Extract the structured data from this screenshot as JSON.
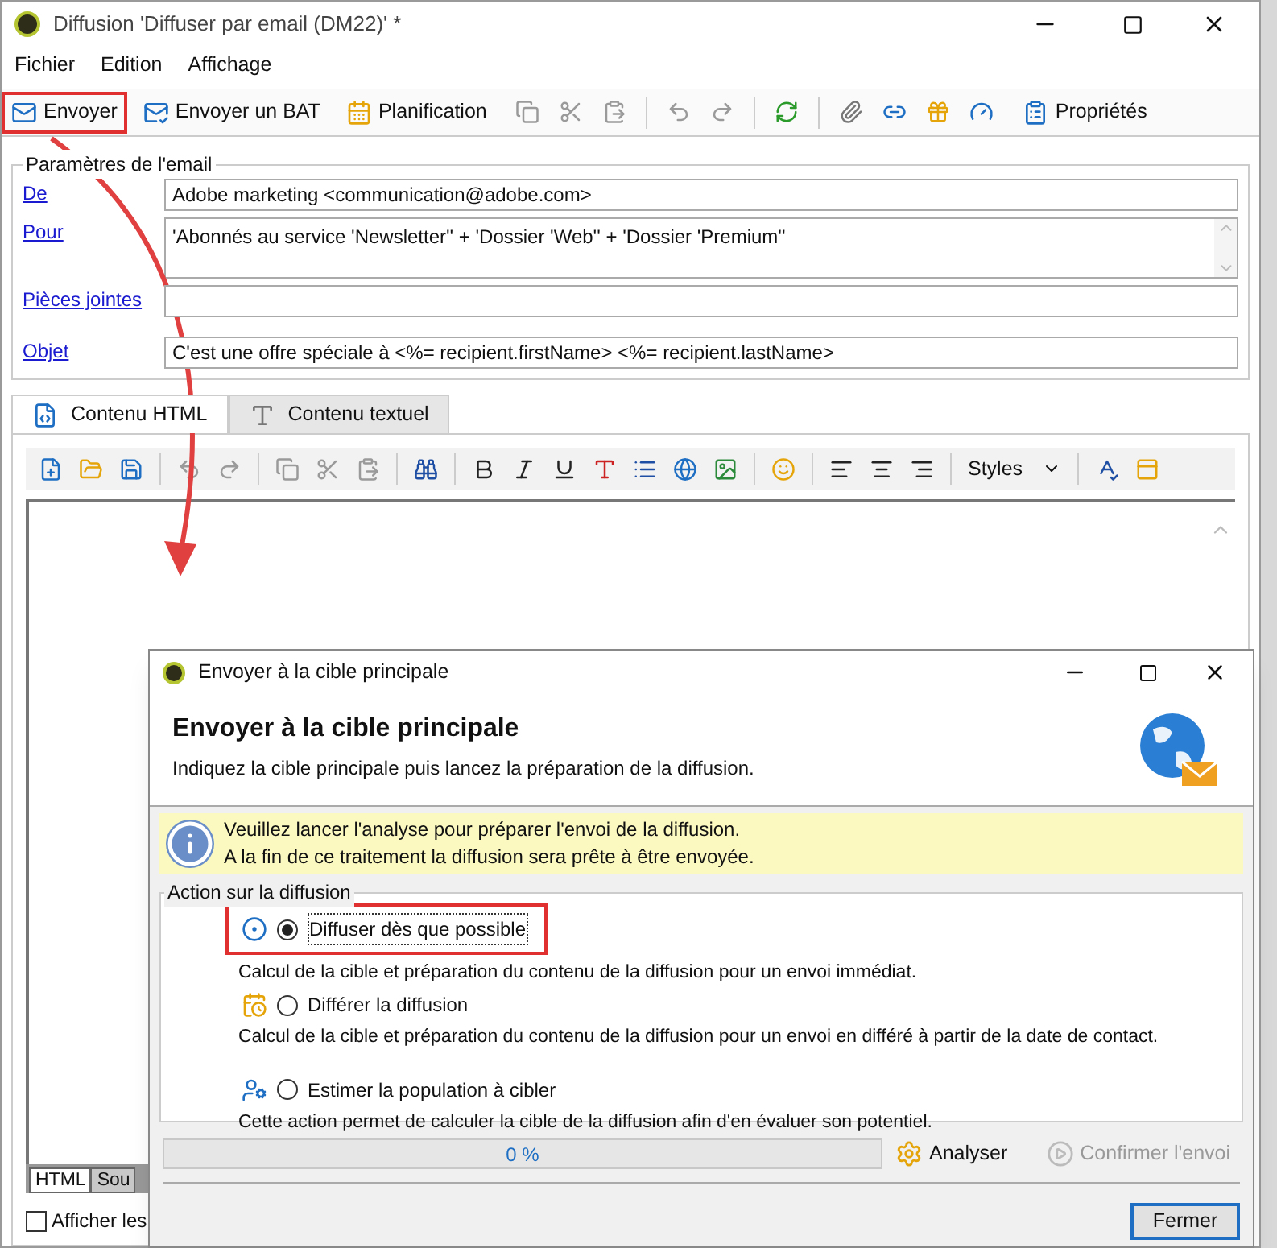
{
  "window": {
    "title": "Diffusion 'Diffuser par email (DM22)' *"
  },
  "menu": [
    "Fichier",
    "Edition",
    "Affichage"
  ],
  "toolbar": [
    {
      "kind": "send",
      "label": "Envoyer",
      "highlighted": true
    },
    {
      "kind": "proof",
      "label": "Envoyer un BAT",
      "highlighted": false
    },
    {
      "kind": "schedule",
      "label": "Planification",
      "highlighted": false
    },
    {
      "kind": "properties",
      "label": "Propriétés",
      "highlighted": false
    }
  ],
  "email_params": {
    "title": "Paramètres de l'email",
    "fields": [
      {
        "kind": "line",
        "label": "De",
        "value": "Adobe marketing <communication@adobe.com>"
      },
      {
        "kind": "area",
        "label": "Pour",
        "value": "'Abonnés au service 'Newsletter'' + 'Dossier 'Web'' + 'Dossier 'Premium''"
      },
      {
        "kind": "line",
        "label": "Pièces jointes"
      },
      {
        "kind": "line",
        "label": "Objet",
        "value": "C'est une offre  spéciale  à  <%= recipient.firstName> <%= recipient.lastName>"
      }
    ]
  },
  "editor": {
    "tabs": [
      {
        "kind": "html",
        "label": "Contenu HTML",
        "selected": true
      },
      {
        "kind": "text",
        "label": "Contenu textuel",
        "selected": false
      }
    ],
    "styles": "Styles",
    "bottom_tabs": [
      {
        "label": "HTML",
        "selected": true
      },
      {
        "label": "Sou",
        "selected": false
      }
    ],
    "checkbox": {
      "label": "Afficher les",
      "checked": false
    }
  },
  "dialog": {
    "title": "Envoyer à la cible principale",
    "heading": "Envoyer à la cible principale",
    "subheading": "Indiquez la cible principale puis lancez la préparation de la diffusion.",
    "info": [
      "Veuillez lancer l'analyse pour préparer l'envoi de la diffusion.",
      "A la fin de ce traitement la diffusion sera prête à être envoyée."
    ],
    "group": "Action sur la diffusion",
    "options": [
      {
        "kind": "now",
        "label": "Diffuser dès que possible",
        "description": "Calcul de la cible et préparation du contenu de la diffusion pour un envoi immédiat.",
        "selected": true,
        "highlighted": true
      },
      {
        "kind": "later",
        "label": "Différer la diffusion",
        "description": "Calcul de la cible et préparation du contenu de la diffusion pour un envoi en différé à partir de la date de contact.",
        "selected": false,
        "highlighted": false
      },
      {
        "kind": "estimate",
        "label": "Estimer la population à cibler",
        "description": "Cette action permet de calculer la cible de la diffusion afin d'en évaluer son potentiel.",
        "selected": false,
        "highlighted": false
      }
    ],
    "progress": {
      "level": 0,
      "reading": "0 %"
    },
    "analyse": "Analyser",
    "confirm": {
      "label": "Confirmer l'envoi",
      "disabled": true
    },
    "close": "Fermer"
  }
}
